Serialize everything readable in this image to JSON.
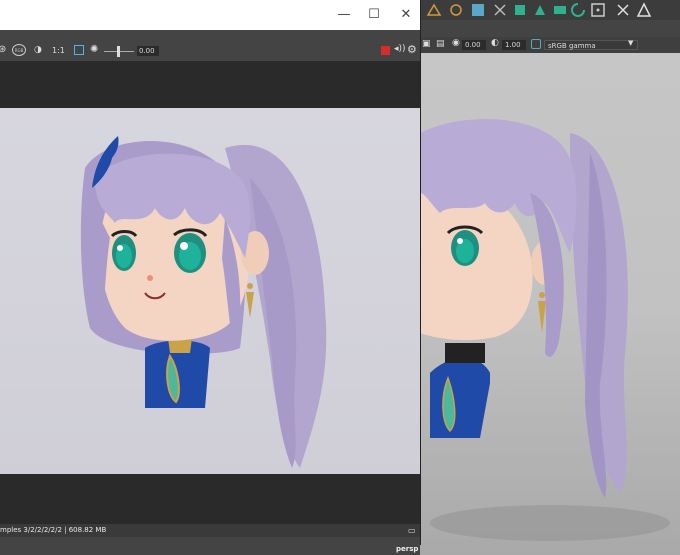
{
  "render_view": {
    "toolbar": {
      "ratio_label": "1:1",
      "exposure_value": "0.00"
    },
    "status": {
      "text": "mples 3/2/2/2/2/2 | 608.82 MB"
    }
  },
  "maya_viewport": {
    "exposure_value": "0.00",
    "gamma_value": "1.00",
    "colorspace_label": "sRGB gamma",
    "camera_label": "persp"
  },
  "icons": {
    "shelf": [
      "shelf-icon",
      "shelf-icon",
      "shelf-icon",
      "shelf-icon",
      "shelf-icon",
      "shelf-icon",
      "shelf-icon",
      "shelf-icon",
      "shelf-icon",
      "shelf-icon"
    ],
    "window_controls": [
      "minimize-icon",
      "maximize-icon",
      "close-icon"
    ]
  },
  "colors": {
    "hair": "#b8acd6",
    "skin": "#f4d5c3",
    "eye": "#1fb29a",
    "dress": "#1f4aa8",
    "gem": "#4fb79a",
    "collar": "#c9a24a",
    "render_bg": "#d5d4dd",
    "viewport_bg": "#c4c4c4",
    "record_red": "#d82b2b"
  }
}
